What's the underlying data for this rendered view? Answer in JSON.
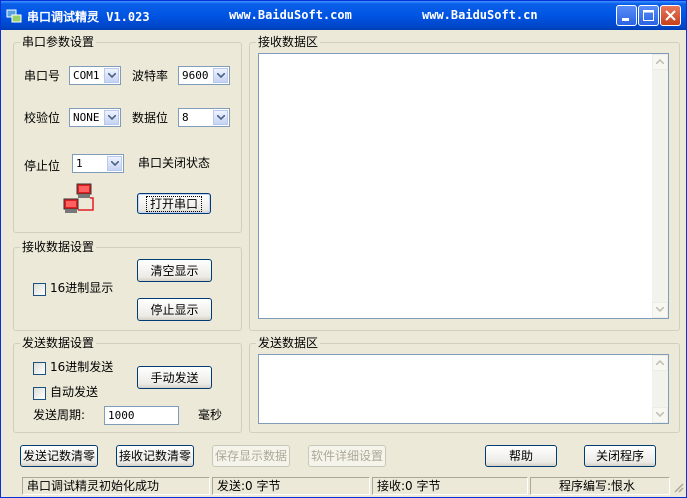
{
  "titlebar": {
    "title": "串口调试精灵 V1.023",
    "url1": "www.BaiduSoft.com",
    "url2": "www.BaiduSoft.cn"
  },
  "serial_params": {
    "legend": "串口参数设置",
    "port_label": "串口号",
    "port_value": "COM1",
    "baud_label": "波特率",
    "baud_value": "9600",
    "parity_label": "校验位",
    "parity_value": "NONE",
    "databits_label": "数据位",
    "databits_value": "8",
    "stopbits_label": "停止位",
    "stopbits_value": "1",
    "port_status": "串口关闭状态",
    "open_button": "打开串口"
  },
  "receive_settings": {
    "legend": "接收数据设置",
    "hex_display": "16进制显示",
    "clear_button": "清空显示",
    "stop_button": "停止显示"
  },
  "send_settings": {
    "legend": "发送数据设置",
    "hex_send": "16进制发送",
    "auto_send": "自动发送",
    "manual_button": "手动发送",
    "period_label": "发送周期:",
    "period_value": "1000",
    "period_unit": "毫秒"
  },
  "receive_area": {
    "legend": "接收数据区"
  },
  "send_area": {
    "legend": "发送数据区"
  },
  "bottom_buttons": {
    "clear_send_count": "发送记数清零",
    "clear_recv_count": "接收记数清零",
    "save_display": "保存显示数据",
    "software_settings": "软件详细设置",
    "help": "帮助",
    "close_program": "关闭程序"
  },
  "statusbar": {
    "message": "串口调试精灵初始化成功",
    "sent": "发送:0 字节",
    "received": "接收:0 字节",
    "author": "程序编写:恨水"
  },
  "colors": {
    "titlebar": "#0054e3",
    "face": "#ece9d8",
    "groupbox_border": "#d0d0bf",
    "input_border": "#7f9db9"
  }
}
